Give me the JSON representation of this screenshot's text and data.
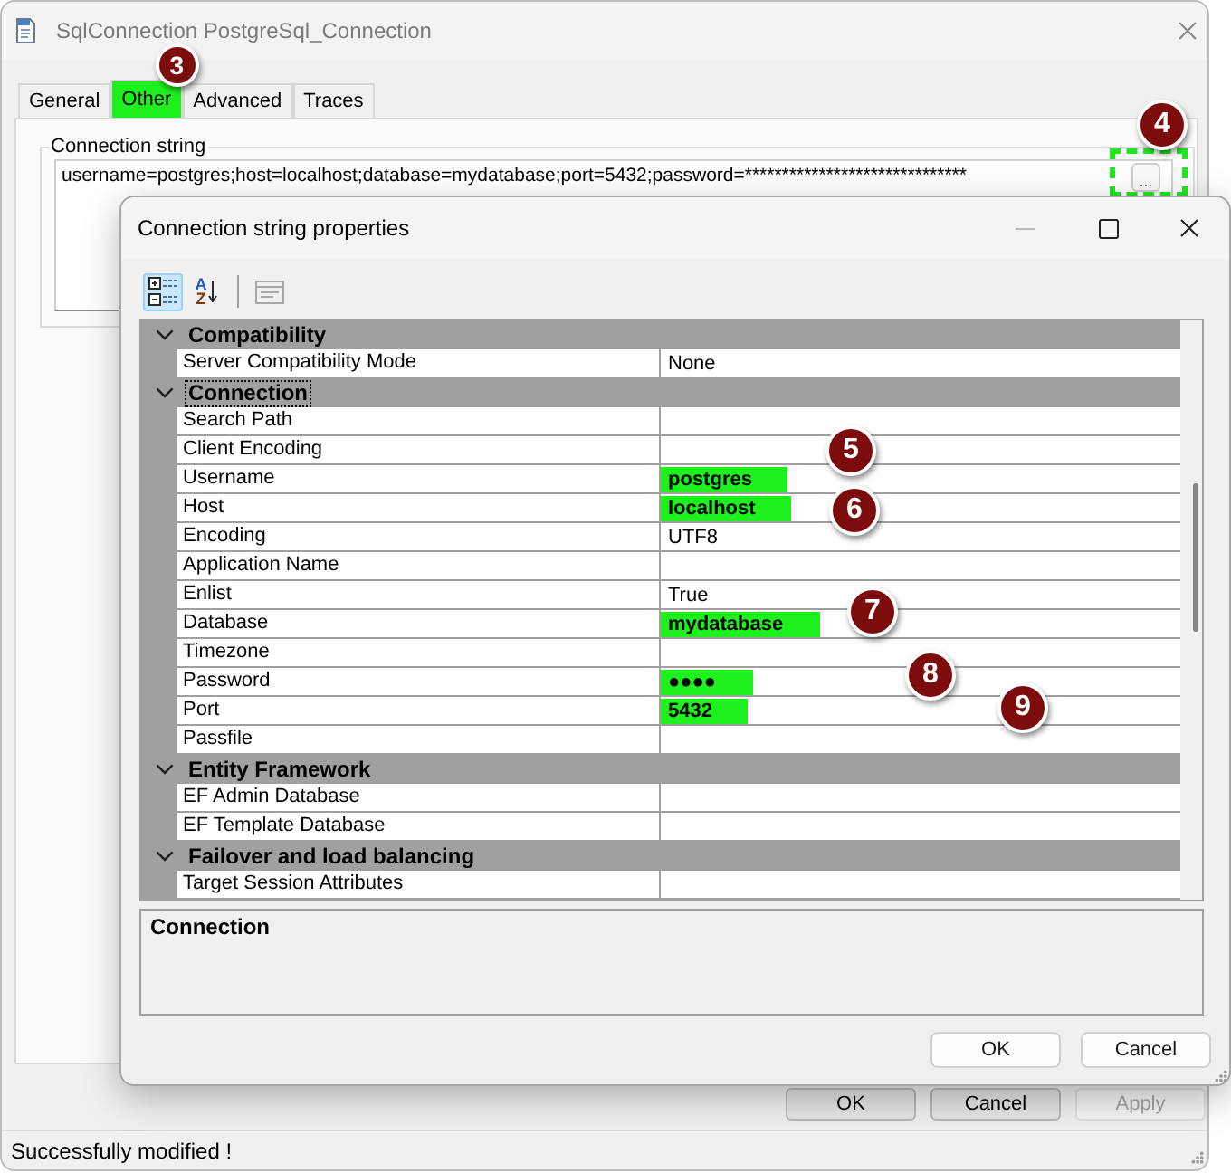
{
  "main_window": {
    "title": "SqlConnection PostgreSql_Connection",
    "tabs": [
      {
        "label": "General",
        "selected": false,
        "highlighted": false
      },
      {
        "label": "Other",
        "selected": true,
        "highlighted": true,
        "marker": "3"
      },
      {
        "label": "Advanced",
        "selected": false,
        "highlighted": false
      },
      {
        "label": "Traces",
        "selected": false,
        "highlighted": false
      }
    ],
    "connection_string": {
      "label": "Connection string",
      "value": "username=postgres;host=localhost;database=mydatabase;port=5432;password=******************************",
      "browse_button": {
        "label": "...",
        "highlighted": true,
        "marker": "4"
      }
    },
    "buttons": [
      {
        "label": "OK",
        "disabled": false
      },
      {
        "label": "Cancel",
        "disabled": false
      },
      {
        "label": "Apply",
        "disabled": true
      }
    ],
    "status_bar": "Successfully modified !"
  },
  "dialog": {
    "title": "Connection string properties",
    "toolbar": [
      {
        "kind": "categorized",
        "selected": true,
        "disabled": false
      },
      {
        "kind": "alphabetical",
        "letters": [
          "A",
          "Z"
        ],
        "selected": false,
        "disabled": false
      },
      {
        "kind": "property_pages",
        "selected": false,
        "disabled": true
      }
    ],
    "categories": [
      {
        "name": "Compatibility",
        "expanded": true,
        "selected": false,
        "properties": [
          {
            "name": "Server Compatibility Mode",
            "value": "None",
            "modified": false,
            "highlighted": false
          }
        ]
      },
      {
        "name": "Connection",
        "expanded": true,
        "selected": true,
        "properties": [
          {
            "name": "Search Path"
          },
          {
            "name": "Client Encoding"
          },
          {
            "name": "Username",
            "value": "postgres",
            "modified": true,
            "highlighted": true,
            "marker": "5"
          },
          {
            "name": "Host",
            "value": "localhost",
            "modified": true,
            "highlighted": true,
            "marker": "6"
          },
          {
            "name": "Encoding",
            "value": "UTF8",
            "modified": false,
            "highlighted": false
          },
          {
            "name": "Application Name"
          },
          {
            "name": "Enlist",
            "value": "True",
            "modified": false,
            "highlighted": false
          },
          {
            "name": "Database",
            "value": "mydatabase",
            "modified": true,
            "highlighted": true,
            "marker": "7"
          },
          {
            "name": "Timezone"
          },
          {
            "name": "Password",
            "value": "●●●●",
            "modified": true,
            "highlighted": true,
            "marker": "8"
          },
          {
            "name": "Port",
            "value": "5432",
            "modified": true,
            "highlighted": true,
            "marker": "9"
          },
          {
            "name": "Passfile"
          }
        ]
      },
      {
        "name": "Entity Framework",
        "expanded": true,
        "selected": false,
        "properties": [
          {
            "name": "EF Admin Database"
          },
          {
            "name": "EF Template Database"
          }
        ]
      },
      {
        "name": "Failover and load balancing",
        "expanded": true,
        "selected": false,
        "properties": [
          {
            "name": "Target Session Attributes"
          }
        ]
      }
    ],
    "description": {
      "title": "Connection"
    },
    "buttons": [
      {
        "label": "OK"
      },
      {
        "label": "Cancel"
      }
    ]
  }
}
